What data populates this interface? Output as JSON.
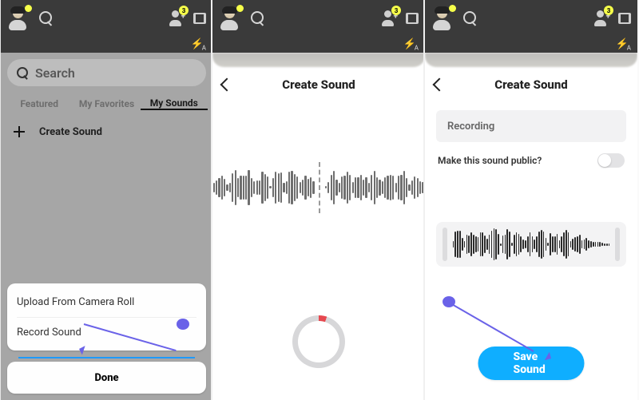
{
  "topbar": {
    "badge": "3"
  },
  "panel1": {
    "search_placeholder": "Search",
    "tabs": {
      "featured": "Featured",
      "favorites": "My Favorites",
      "sounds": "My Sounds"
    },
    "create_label": "Create Sound",
    "sheet": {
      "upload": "Upload From Camera Roll",
      "record": "Record Sound",
      "done": "Done"
    }
  },
  "panel2": {
    "title": "Create Sound"
  },
  "panel3": {
    "title": "Create Sound",
    "recording_label": "Recording",
    "public_label": "Make this sound public?",
    "save_label": "Save Sound"
  }
}
